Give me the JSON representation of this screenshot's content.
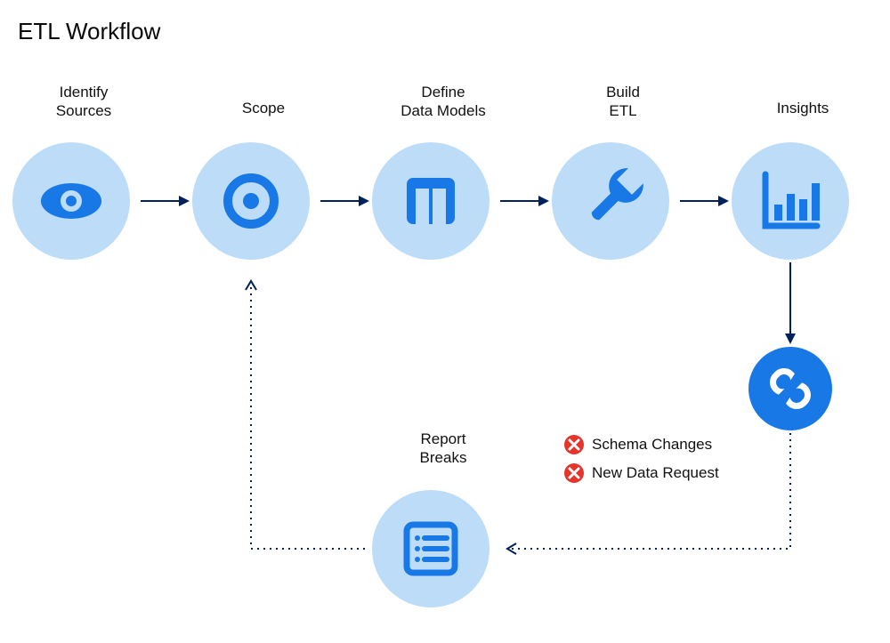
{
  "title": "ETL Workflow",
  "nodes": {
    "identify": {
      "label": "Identify\nSources"
    },
    "scope": {
      "label": "Scope"
    },
    "models": {
      "label": "Define\nData Models"
    },
    "build": {
      "label": "Build\nETL"
    },
    "insights": {
      "label": "Insights"
    },
    "breaks": {
      "label": "Report\nBreaks"
    }
  },
  "causes": {
    "schema": {
      "label": "Schema Changes"
    },
    "request": {
      "label": "New Data Request"
    }
  },
  "flow": {
    "main": [
      "identify",
      "scope",
      "models",
      "build",
      "insights"
    ],
    "down": [
      "insights",
      "broken-link"
    ],
    "feedback": [
      "broken-link",
      "breaks",
      "scope"
    ]
  },
  "colors": {
    "nodeLight": "#bcdcf7",
    "nodeDark": "#1878e5",
    "iconBlue": "#1878e5",
    "arrowNavy": "#00215b",
    "errorRed": "#e5342a"
  }
}
